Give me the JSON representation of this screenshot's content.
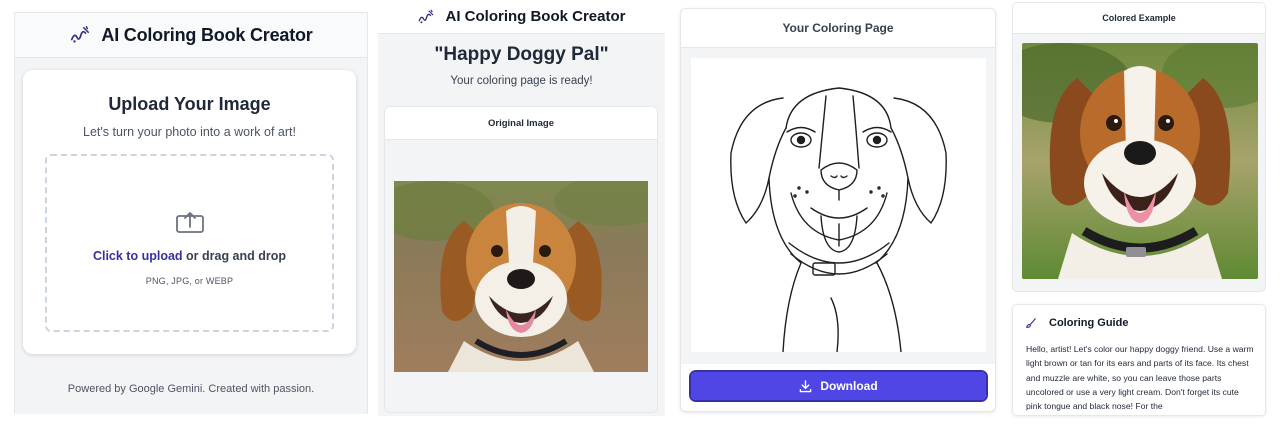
{
  "app": {
    "title": "AI Coloring Book Creator"
  },
  "upload": {
    "heading": "Upload Your Image",
    "subtitle": "Let's turn your photo into a work of art!",
    "click_label": "Click to upload",
    "drag_label": " or drag and drop",
    "formats": "PNG, JPG, or WEBP"
  },
  "footer": {
    "text": "Powered by Google Gemini. Created with passion."
  },
  "result": {
    "title": "\"Happy Doggy Pal\"",
    "status": "Your coloring page is ready!",
    "original_label": "Original Image"
  },
  "coloring_page": {
    "header": "Your Coloring Page",
    "download_label": "Download"
  },
  "colored_example": {
    "header": "Colored Example"
  },
  "guide": {
    "title": "Coloring Guide",
    "text": "Hello, artist! Let's color our happy doggy friend. Use a warm light brown or tan for its ears and parts of its face. Its chest and muzzle are white, so you can leave those parts uncolored or use a very light cream. Don't forget its cute pink tongue and black nose! For the"
  },
  "colors": {
    "accent": "#4f46e5",
    "link": "#3730a3",
    "panel_bg": "#f3f4f6"
  },
  "icons": [
    "logo-icon",
    "upload-icon",
    "download-icon",
    "brush-icon"
  ]
}
